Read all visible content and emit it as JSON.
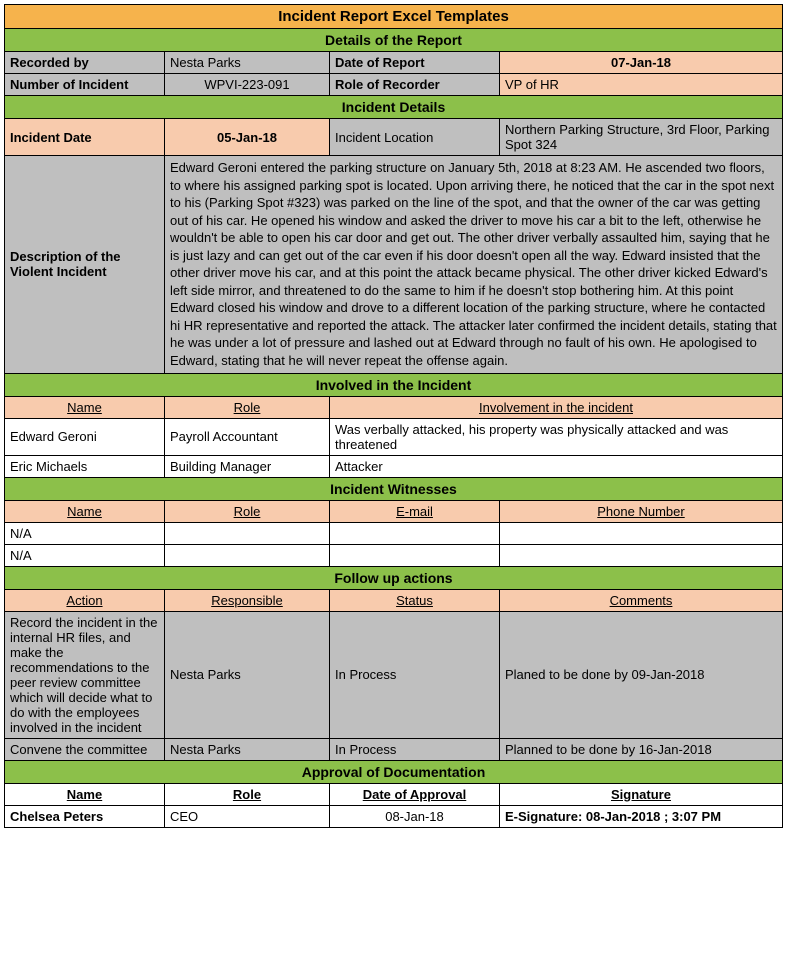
{
  "title": "Incident Report Excel Templates",
  "sections": {
    "details": "Details of the Report",
    "incident": "Incident Details",
    "involved": "Involved in the Incident",
    "witnesses": "Incident Witnesses",
    "followup": "Follow up actions",
    "approval": "Approval of Documentation"
  },
  "report": {
    "recorded_by_label": "Recorded by",
    "recorded_by": "Nesta Parks",
    "date_label": "Date of Report",
    "date": "07-Jan-18",
    "number_label": "Number of Incident",
    "number": "WPVI-223-091",
    "role_label": "Role of Recorder",
    "role": "VP of HR"
  },
  "incident": {
    "date_label": "Incident Date",
    "date": "05-Jan-18",
    "location_label": "Incident Location",
    "location": "Northern Parking Structure, 3rd Floor, Parking Spot 324",
    "description_label": "Description of the Violent Incident",
    "description": "Edward Geroni entered the parking structure on January 5th, 2018 at 8:23 AM. He ascended two floors, to where his assigned parking spot is located. Upon arriving there, he noticed that the car in the spot next to his (Parking Spot #323) was parked on the line of the spot, and that the owner of the car was getting out of his car. He opened his window and asked the driver to move his car a bit to the left, otherwise he wouldn't be able to open his car door and get out. The other driver verbally assaulted him, saying that he is just lazy and can get out of the car even if his door doesn't open all the way. Edward insisted that the other driver move his car, and at this point the attack became physical. The other driver kicked Edward's left side mirror, and threatened to do the same to him if he doesn't stop bothering him. At this point Edward closed his window and drove to a different location of the parking structure, where he contacted hi HR representative and reported the attack. The attacker later confirmed the incident details, stating that he was under a lot of pressure and lashed out at Edward through no fault of his own. He apologised to Edward, stating that he will never repeat the offense again."
  },
  "involved_headers": {
    "name": "Name",
    "role": "Role",
    "involvement": "Involvement in the incident"
  },
  "involved": [
    {
      "name": "Edward Geroni",
      "role": "Payroll Accountant",
      "involvement": "Was verbally attacked, his property was physically attacked and was threatened"
    },
    {
      "name": "Eric Michaels",
      "role": "Building Manager",
      "involvement": "Attacker"
    }
  ],
  "witness_headers": {
    "name": "Name",
    "role": "Role",
    "email": "E-mail",
    "phone": "Phone Number"
  },
  "witnesses": [
    {
      "name": "N/A",
      "role": "",
      "email": "",
      "phone": ""
    },
    {
      "name": "N/A",
      "role": "",
      "email": "",
      "phone": ""
    }
  ],
  "followup_headers": {
    "action": "Action",
    "responsible": "Responsible",
    "status": "Status",
    "comments": "Comments"
  },
  "followup": [
    {
      "action": "Record the incident in the internal HR files, and make the recommendations to the peer review committee which will decide what to do with the employees involved in the incident",
      "responsible": "Nesta Parks",
      "status": "In Process",
      "comments": "Planed to be done by 09-Jan-2018"
    },
    {
      "action": "Convene the committee",
      "responsible": "Nesta Parks",
      "status": "In Process",
      "comments": "Planned to be done by 16-Jan-2018"
    }
  ],
  "approval_headers": {
    "name": "Name",
    "role": "Role",
    "date": "Date of Approval",
    "signature": "Signature"
  },
  "approval": {
    "name": "Chelsea Peters",
    "role": "CEO",
    "date": "08-Jan-18",
    "signature": "E-Signature: 08-Jan-2018 ; 3:07 PM"
  }
}
